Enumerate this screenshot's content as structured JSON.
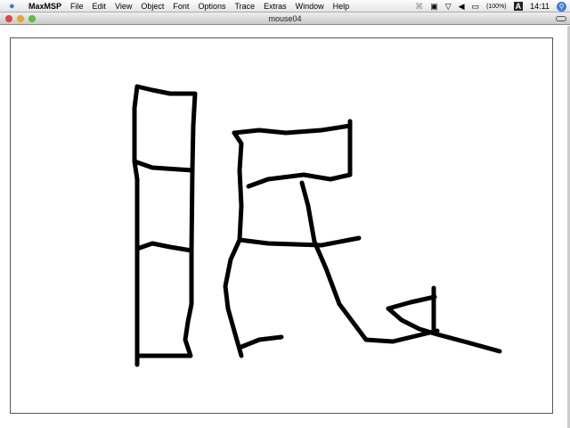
{
  "menubar": {
    "app": "MaxMSP",
    "items": [
      "File",
      "Edit",
      "View",
      "Object",
      "Font",
      "Options",
      "Trace",
      "Extras",
      "Window",
      "Help"
    ],
    "battery": "(100%)",
    "clock": "14:11",
    "input_menu": "A"
  },
  "window": {
    "title": "mouse04"
  }
}
